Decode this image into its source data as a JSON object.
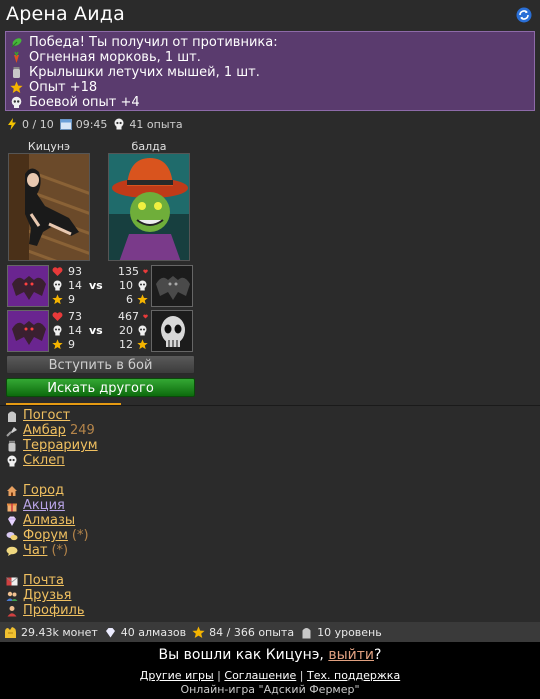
{
  "header": {
    "title": "Арена Аида"
  },
  "victory": {
    "lines": [
      {
        "icon": "leaf-icon",
        "text": "Победа! Ты получил от противника:"
      },
      {
        "icon": "carrot-icon",
        "text": "Огненная морковь, 1 шт."
      },
      {
        "icon": "jar-icon",
        "text": "Крылышки летучих мышей, 1 шт."
      },
      {
        "icon": "star-icon",
        "text": "Опыт +18"
      },
      {
        "icon": "skull-icon",
        "text": "Боевой опыт +4"
      }
    ]
  },
  "status": {
    "energy": "0 / 10",
    "time": "09:45",
    "battle_exp": "41 опыта"
  },
  "players": {
    "left_name": "Кицунэ",
    "right_name": "балда"
  },
  "pets": [
    {
      "left": {
        "hp": "93",
        "atk": "14",
        "lvl": "9"
      },
      "right": {
        "hp": "135",
        "atk": "10",
        "lvl": "6"
      },
      "vs": "vs"
    },
    {
      "left": {
        "hp": "73",
        "atk": "14",
        "lvl": "9"
      },
      "right": {
        "hp": "467",
        "atk": "20",
        "lvl": "12"
      },
      "vs": "vs"
    }
  ],
  "buttons": {
    "join": "Вступить в бой",
    "search": "Искать другого"
  },
  "menu": {
    "group1": [
      {
        "icon": "tombstone-icon",
        "label": "Погост",
        "extra": ""
      },
      {
        "icon": "shovel-icon",
        "label": "Амбар",
        "extra": "249"
      },
      {
        "icon": "jar-icon",
        "label": "Террариум",
        "extra": ""
      },
      {
        "icon": "skull-icon",
        "label": "Склеп",
        "extra": ""
      }
    ],
    "group2": [
      {
        "icon": "house-icon",
        "label": "Город",
        "extra": ""
      },
      {
        "icon": "gift-icon",
        "label": "Акция",
        "extra": ""
      },
      {
        "icon": "diamond-icon",
        "label": "Алмазы",
        "extra": ""
      },
      {
        "icon": "forum-icon",
        "label": "Форум",
        "extra": "(*)"
      },
      {
        "icon": "chat-icon",
        "label": "Чат",
        "extra": "(*)"
      }
    ],
    "group3": [
      {
        "icon": "mail-icon",
        "label": "Почта",
        "extra": ""
      },
      {
        "icon": "friends-icon",
        "label": "Друзья",
        "extra": ""
      },
      {
        "icon": "profile-icon",
        "label": "Профиль",
        "extra": ""
      }
    ]
  },
  "bottombar": {
    "coins": "29.43k монет",
    "diamonds": "40 алмазов",
    "exp": "84 / 366 опыта",
    "level": "10 уровень"
  },
  "footer": {
    "logged_in_prefix": "Вы вошли как Кицунэ,",
    "logout": "выйти",
    "logged_in_suffix": "?",
    "link_games": "Другие игры",
    "link_terms": "Соглашение",
    "link_support": "Тех. поддержка",
    "sep": "|",
    "copyright": "Онлайн-игра \"Адский Фермер\""
  },
  "colors": {
    "victory_bg": "#5a3b6e",
    "link": "#f0c060",
    "accent_line": "#e69a12",
    "button_green": "#1f8a1f"
  }
}
